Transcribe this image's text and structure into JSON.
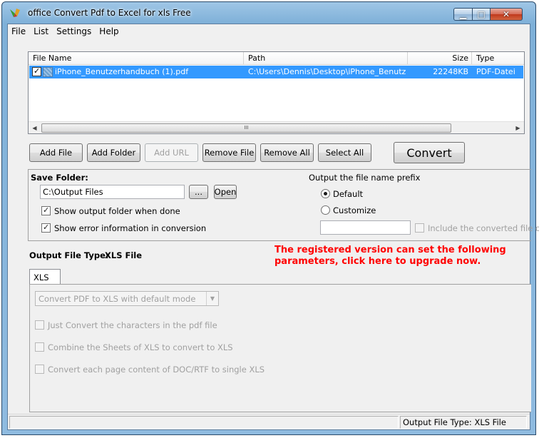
{
  "window": {
    "title": "office Convert Pdf to Excel for xls Free"
  },
  "menu": [
    "File",
    "List",
    "Settings",
    "Help"
  ],
  "filelist": {
    "columns": [
      "File Name",
      "Path",
      "Size",
      "Type"
    ],
    "rows": [
      {
        "name": "iPhone_Benutzerhandbuch (1).pdf",
        "path": "C:\\Users\\Dennis\\Desktop\\iPhone_Benutze...",
        "size": "22248KB",
        "type": "PDF-Datei",
        "checked": true,
        "selected": true
      }
    ],
    "scroll_grip": "III"
  },
  "buttons": {
    "add_file": "Add File",
    "add_folder": "Add Folder",
    "add_url": "Add URL",
    "remove_file": "Remove File",
    "remove_all": "Remove All",
    "select_all": "Select All",
    "convert": "Convert"
  },
  "save": {
    "label": "Save Folder:",
    "folder": "C:\\Output Files",
    "browse": "...",
    "open": "Open",
    "show_output": "Show output folder when done",
    "show_error": "Show error information in conversion"
  },
  "prefix": {
    "title": "Output the file name prefix",
    "default": "Default",
    "customize": "Customize",
    "value": "",
    "include_label": "Include the converted file orde"
  },
  "output_type": {
    "label": "Output File Type:",
    "value": "XLS File"
  },
  "upgrade": {
    "line1": "The registered version can set the following",
    "line2": "parameters, click here to upgrade now."
  },
  "tabs": [
    "XLS"
  ],
  "xls": {
    "mode": "Convert PDF to XLS with default mode",
    "opt1": "Just Convert the characters in the pdf file",
    "opt2": "Combine the Sheets of XLS to convert to XLS",
    "opt3": "Convert each page content of DOC/RTF to single XLS"
  },
  "status": {
    "text": "Output File Type:  XLS File"
  }
}
